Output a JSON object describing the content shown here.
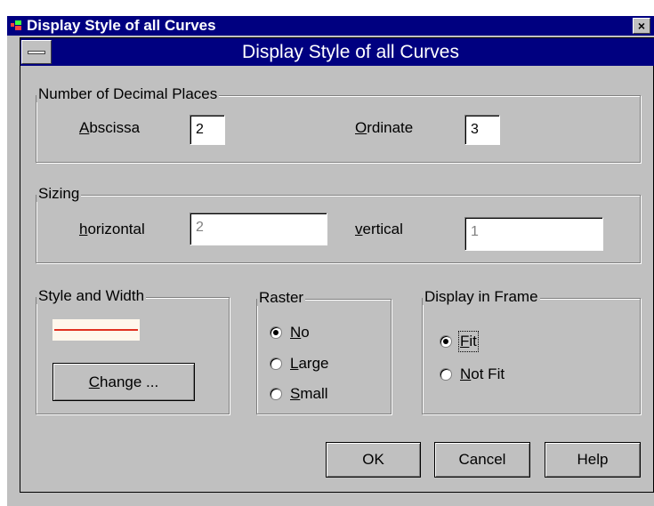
{
  "window": {
    "title": "Display Style of all Curves",
    "close_glyph": "×"
  },
  "dialog": {
    "title": "Display Style of all Curves"
  },
  "decimal_places": {
    "legend": "Number of Decimal Places",
    "abscissa": {
      "label": "Abscissa",
      "mnemonic": "A",
      "rest": "bscissa",
      "value": "2"
    },
    "ordinate": {
      "label": "Ordinate",
      "mnemonic": "O",
      "rest": "rdinate",
      "value": "3"
    }
  },
  "sizing": {
    "legend": "Sizing",
    "horizontal": {
      "label": "horizontal",
      "mnemonic": "h",
      "rest": "orizontal",
      "value": "2"
    },
    "vertical": {
      "label": "vertical",
      "mnemonic": "v",
      "rest": "ertical",
      "value": "1"
    }
  },
  "style_width": {
    "legend": "Style and Width",
    "line_color": "#e03020",
    "change_button": {
      "label": "Change ...",
      "mnemonic": "C",
      "rest": "hange ..."
    }
  },
  "raster": {
    "legend": "Raster",
    "options": [
      {
        "label": "No",
        "mnemonic": "N",
        "rest": "o",
        "selected": true
      },
      {
        "label": "Large",
        "mnemonic": "L",
        "rest": "arge",
        "selected": false
      },
      {
        "label": "Small",
        "mnemonic": "S",
        "rest": "mall",
        "selected": false
      }
    ]
  },
  "display_frame": {
    "legend": "Display in Frame",
    "options": [
      {
        "label": "Fit",
        "mnemonic": "F",
        "rest": "it",
        "selected": true
      },
      {
        "label": "Not Fit",
        "mnemonic": "N",
        "rest": "ot Fit",
        "selected": false
      }
    ]
  },
  "buttons": {
    "ok": "OK",
    "cancel": "Cancel",
    "help": "Help"
  },
  "colors": {
    "title_bar": "#000080",
    "face": "#c0c0c0"
  }
}
